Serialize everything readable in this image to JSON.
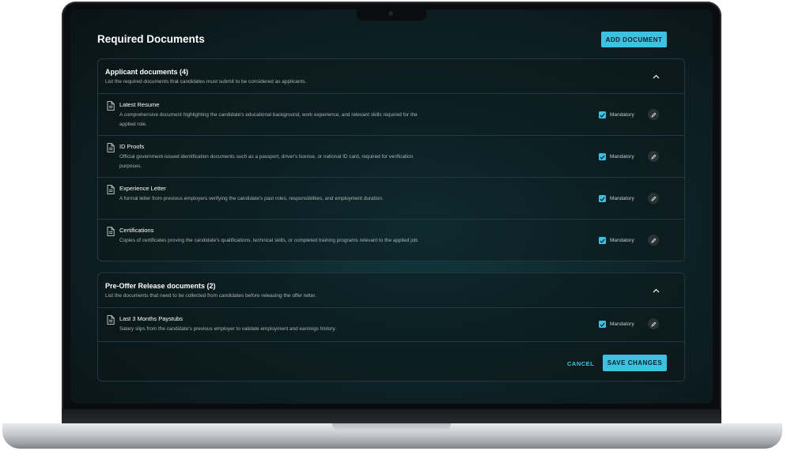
{
  "page": {
    "title": "Required Documents",
    "add_document_label": "ADD DOCUMENT"
  },
  "sections": [
    {
      "title": "Applicant documents (4)",
      "description": "List the required documents that candidates must submit to be considered as applicants.",
      "documents": [
        {
          "title": "Latest Resume",
          "description": "A comprehensive document highlighting the candidate's educational background, work experience, and relevant skills required for the applied role.",
          "mandatory_label": "Mandatory",
          "mandatory": true
        },
        {
          "title": "ID Proofs",
          "description": "Official government-issued identification documents such as a passport, driver's license, or national ID card, required for verification purposes.",
          "mandatory_label": "Mandatory",
          "mandatory": true
        },
        {
          "title": "Experience Letter",
          "description": "A formal letter from previous employers verifying the candidate's past roles, responsibilities, and employment duration.",
          "mandatory_label": "Mandatory",
          "mandatory": true
        },
        {
          "title": "Certifications",
          "description": "Copies of certificates proving the candidate's qualifications, technical skills, or completed training programs relevant to the applied job.",
          "mandatory_label": "Mandatory",
          "mandatory": true
        }
      ]
    },
    {
      "title": "Pre-Offer Release documents (2)",
      "description": "List the documents that need to be collected from candidates before releasing the offer letter.",
      "documents": [
        {
          "title": "Last 3 Months Paystubs",
          "description": "Salary slips from the candidate's previous employer to validate employment and earnings history.",
          "mandatory_label": "Mandatory",
          "mandatory": true
        }
      ]
    }
  ],
  "footer": {
    "cancel_label": "CANCEL",
    "save_label": "SAVE CHANGES"
  },
  "colors": {
    "accent": "#3ec1e0",
    "background": "#0d2428",
    "border": "#25393d",
    "text_primary": "#ffffff",
    "text_secondary": "#a9b4b7"
  },
  "icons": {
    "document": "document-icon",
    "chevron": "chevron-up-icon",
    "edit": "pencil-icon",
    "checkbox": "check-icon"
  }
}
